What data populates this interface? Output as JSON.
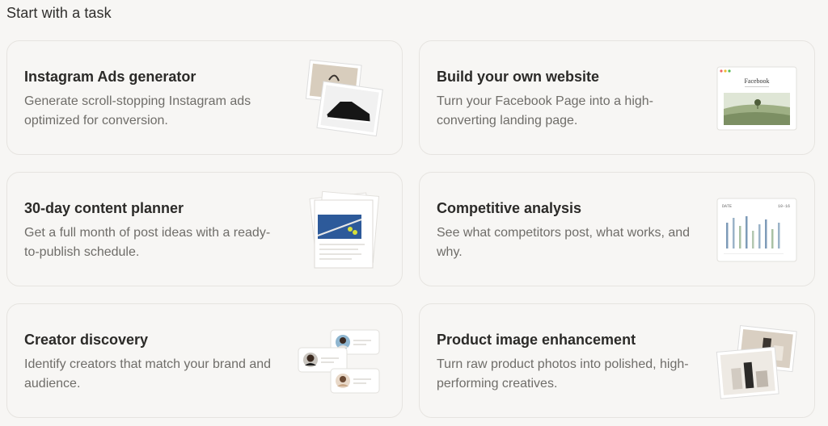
{
  "heading": "Start with a task",
  "cards": [
    {
      "title": "Instagram Ads generator",
      "desc": "Generate scroll-stopping Instagram ads optimized for conversion."
    },
    {
      "title": "Build your own website",
      "desc": "Turn your Facebook Page into a high-converting landing page.",
      "thumb_label": "Facebook"
    },
    {
      "title": "30-day content planner",
      "desc": "Get a full month of post ideas with a ready-to-publish schedule."
    },
    {
      "title": "Competitive analysis",
      "desc": "See what competitors post, what works, and why.",
      "thumb_header_left": "DATE",
      "thumb_header_right": "10-16"
    },
    {
      "title": "Creator discovery",
      "desc": "Identify creators that match your brand and audience."
    },
    {
      "title": "Product image enhancement",
      "desc": "Turn raw product photos into polished, high-performing creatives."
    }
  ]
}
